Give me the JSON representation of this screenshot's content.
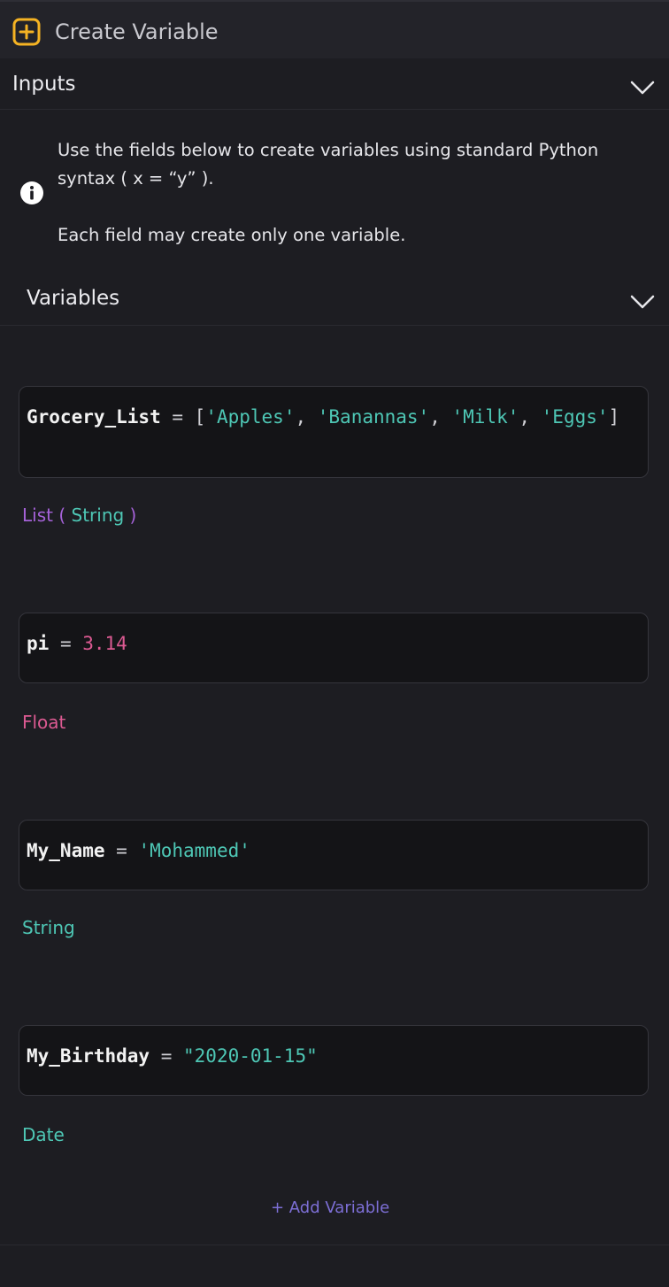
{
  "titlebar": {
    "title": "Create Variable",
    "icon": "plus-square-icon",
    "accent": "#f5b323"
  },
  "inputs_section": {
    "title": "Inputs",
    "expanded": true
  },
  "info": {
    "line1": "Use the fields below to create variables using standard Python",
    "line2": "syntax ( x = “y” ).",
    "line3": "Each field may create only one variable."
  },
  "variables_section": {
    "title": "Variables",
    "expanded": true
  },
  "variables": [
    {
      "name": "Grocery_List",
      "op": " = ",
      "open": "[",
      "items": [
        "'Apples'",
        "'Banannas'",
        "'Milk'",
        "'Eggs'"
      ],
      "sep": ", ",
      "close": "]",
      "type_outer": "List",
      "type_open": " ( ",
      "type_inner": "String",
      "type_close": " )"
    },
    {
      "name": "pi",
      "op": " = ",
      "value": "3.14",
      "type": "Float"
    },
    {
      "name": "My_Name",
      "op": " = ",
      "value": "'Mohammed'",
      "type": "String"
    },
    {
      "name": "My_Birthday",
      "op": " = ",
      "value": "\"2020-01-15\"",
      "type": "Date"
    }
  ],
  "add_button": {
    "label": "+ Add Variable"
  },
  "colors": {
    "background": "#1d1d22",
    "string": "#4ec7b5",
    "number": "#dc5a92",
    "list_type": "#a562d8",
    "add_button": "#7d6fd6"
  }
}
